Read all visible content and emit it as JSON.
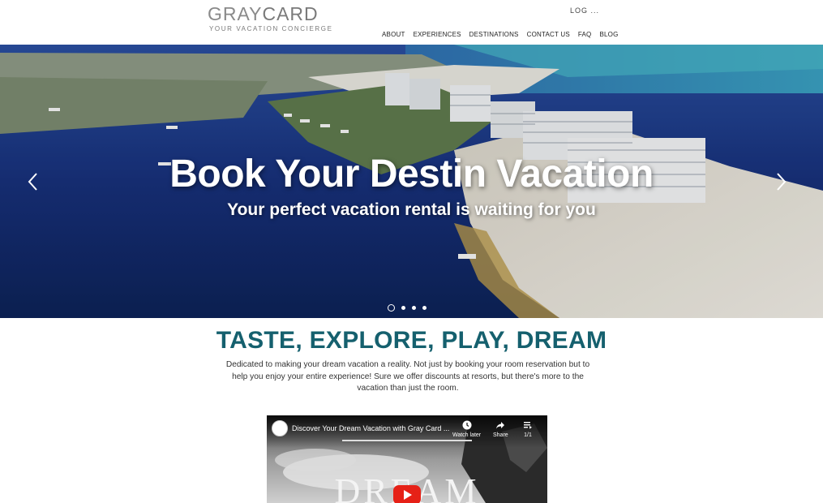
{
  "header": {
    "logo_main_gray": "GRAY",
    "logo_main_card": "CARD",
    "logo_tagline": "YOUR VACATION CONCIERGE",
    "login_label": "LOG ...",
    "nav": [
      "ABOUT",
      "EXPERIENCES",
      "DESTINATIONS",
      "CONTACT US",
      "FAQ",
      "BLOG"
    ]
  },
  "hero": {
    "title": "Book Your Destin Vacation",
    "subtitle": "Your perfect vacation rental is waiting for you",
    "slide_count": 4,
    "active_slide": 1
  },
  "intro": {
    "heading": "TASTE, EXPLORE, PLAY, DREAM",
    "body": "Dedicated to making your dream vacation a reality. Not just by booking your room reservation but to help you enjoy your entire experience! Sure we offer discounts at resorts, but there's more to the vacation than just the room."
  },
  "video": {
    "title": "Discover Your Dream Vacation with Gray Card ...",
    "watch_later": "Watch later",
    "share": "Share",
    "playlist": "1/1",
    "overlay_word": "DREAM"
  },
  "colors": {
    "accent": "#15606e",
    "youtube_red": "#e62117"
  }
}
